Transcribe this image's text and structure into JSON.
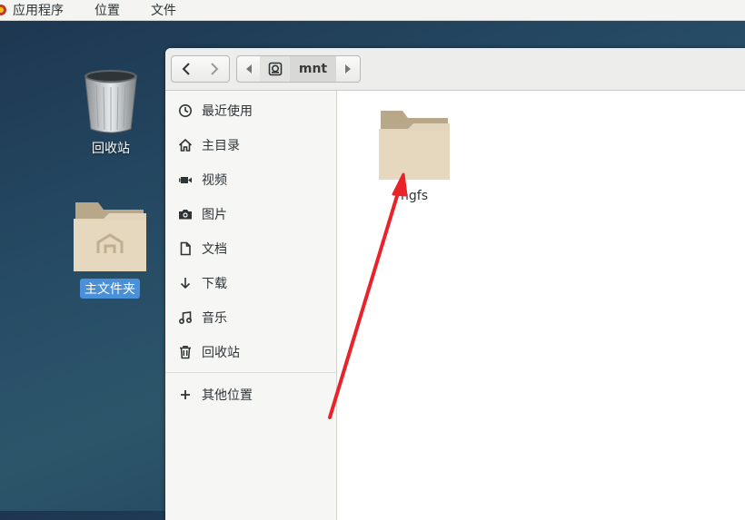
{
  "topbar": {
    "menus": [
      "应用程序",
      "位置",
      "文件"
    ]
  },
  "desktop": {
    "trash_label": "回收站",
    "home_label": "主文件夹"
  },
  "window": {
    "path": {
      "current": "mnt"
    },
    "sidebar": {
      "items": [
        {
          "label": "最近使用",
          "icon": "clock-icon"
        },
        {
          "label": "主目录",
          "icon": "home-icon"
        },
        {
          "label": "视频",
          "icon": "video-icon"
        },
        {
          "label": "图片",
          "icon": "camera-icon"
        },
        {
          "label": "文档",
          "icon": "document-icon"
        },
        {
          "label": "下载",
          "icon": "download-icon"
        },
        {
          "label": "音乐",
          "icon": "music-icon"
        },
        {
          "label": "回收站",
          "icon": "trash-icon"
        }
      ],
      "other_locations": "其他位置"
    },
    "files": [
      {
        "name": "hgfs",
        "icon": "folder-icon"
      }
    ]
  },
  "colors": {
    "selection": "#4a90d9",
    "arrow": "#e8232a",
    "folder": "#d9c7a8"
  }
}
